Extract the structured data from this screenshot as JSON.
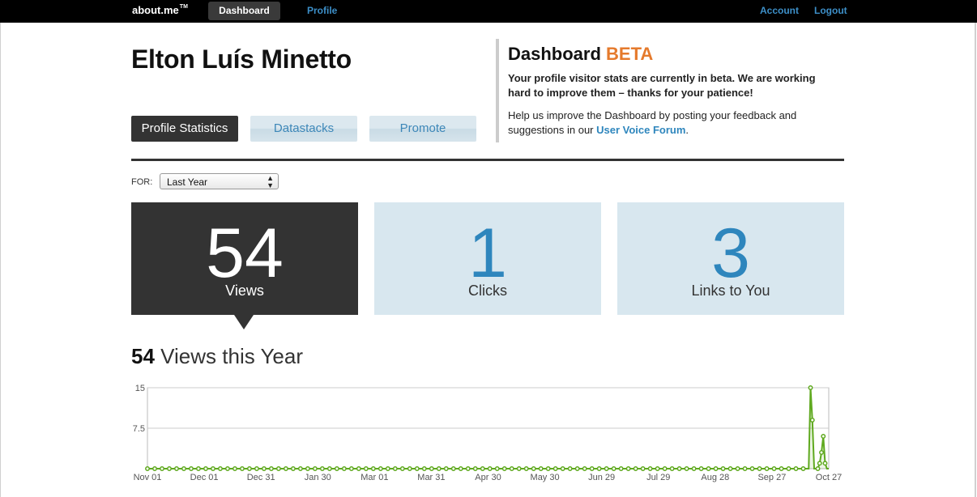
{
  "topbar": {
    "logo": "about.me",
    "logo_tm": "TM",
    "nav": {
      "dashboard": "Dashboard",
      "profile": "Profile",
      "account": "Account",
      "logout": "Logout"
    }
  },
  "profile": {
    "name": "Elton Luís Minetto"
  },
  "tabs": {
    "profile_statistics": "Profile Statistics",
    "datastacks": "Datastacks",
    "promote": "Promote"
  },
  "beta_notice": {
    "title": "Dashboard",
    "title_badge": "BETA",
    "bold_text": "Your profile visitor stats are currently in beta. We are working hard to improve them – thanks for your patience!",
    "help_prefix": "Help us improve the Dashboard by posting your feedback and suggestions in our ",
    "help_link": "User Voice Forum",
    "help_suffix": "."
  },
  "filter": {
    "label": "FOR:",
    "selected": "Last Year"
  },
  "stats": {
    "views": {
      "value": "54",
      "label": "Views"
    },
    "clicks": {
      "value": "1",
      "label": "Clicks"
    },
    "links": {
      "value": "3",
      "label": "Links to You"
    }
  },
  "chart_heading": {
    "count": "54",
    "text": "Views this Year"
  },
  "colors": {
    "accent": "#e57a2c",
    "link": "#2e86bd",
    "series": "#5fa91f",
    "dark": "#333333",
    "tile_bg": "#d8e7ef"
  },
  "chart_data": {
    "type": "line",
    "title": "",
    "xlabel": "",
    "ylabel": "",
    "ylim": [
      0,
      15
    ],
    "yticks": [
      "15",
      "7.5"
    ],
    "x_tick_labels": [
      "Nov 01",
      "Dec 01",
      "Dec 31",
      "Jan 30",
      "Mar 01",
      "Mar 31",
      "Apr 30",
      "May 30",
      "Jun 29",
      "Jul 29",
      "Aug 28",
      "Sep 27",
      "Oct 27"
    ],
    "grid": true,
    "series": [
      {
        "values": [
          0,
          0,
          0,
          0,
          0,
          0,
          0,
          0,
          0,
          0,
          0,
          0,
          0,
          0,
          0,
          0,
          0,
          0,
          0,
          0,
          0,
          0,
          0,
          0,
          0,
          0,
          0,
          0,
          0,
          0,
          0,
          0,
          0,
          0,
          0,
          0,
          0,
          0,
          0,
          0,
          0,
          0,
          0,
          0,
          0,
          0,
          0,
          0,
          0,
          0,
          0,
          0,
          0,
          0,
          0,
          0,
          0,
          0,
          0,
          0,
          0,
          0,
          0,
          0,
          0,
          0,
          0,
          0,
          0,
          0,
          0,
          0,
          0,
          0,
          0,
          0,
          0,
          0,
          0,
          0,
          0,
          0,
          0,
          0,
          0,
          0,
          0,
          0,
          0,
          0,
          0,
          0,
          0,
          0,
          0,
          0,
          0,
          0,
          0,
          0,
          0,
          0,
          0,
          0,
          0,
          0,
          0,
          0,
          0,
          0,
          0,
          0,
          0,
          0,
          0,
          0,
          0,
          0,
          0,
          0,
          0,
          0,
          0,
          0,
          0,
          0,
          0,
          0,
          0,
          0,
          0,
          0,
          0,
          0,
          0,
          0,
          0,
          0,
          0,
          0,
          0,
          0,
          0,
          0,
          0,
          0,
          0,
          0,
          0,
          0,
          0,
          0,
          0,
          0,
          0,
          0,
          0,
          0,
          0,
          0,
          0,
          0,
          0,
          0,
          0,
          0,
          0,
          0,
          0,
          0,
          0,
          0,
          0,
          0,
          0,
          0,
          0,
          0,
          0,
          0,
          0,
          0,
          0,
          0,
          0,
          0,
          0,
          0,
          0,
          0,
          0,
          0,
          0,
          0,
          0,
          0,
          0,
          0,
          0,
          0,
          0,
          0,
          0,
          0,
          0,
          0,
          0,
          0,
          0,
          0,
          0,
          0,
          0,
          0,
          0,
          0,
          0,
          0,
          0,
          0,
          0,
          0,
          0,
          0,
          0,
          0,
          0,
          0,
          0,
          0,
          0,
          0,
          0,
          0,
          0,
          0,
          0,
          0,
          0,
          0,
          0,
          0,
          0,
          0,
          0,
          0,
          0,
          0,
          0,
          0,
          0,
          0,
          0,
          0,
          0,
          0,
          0,
          0,
          0,
          0,
          0,
          0,
          0,
          0,
          0,
          0,
          0,
          0,
          0,
          0,
          0,
          0,
          0,
          0,
          0,
          0,
          0,
          0,
          0,
          0,
          0,
          0,
          0,
          0,
          0,
          0,
          0,
          0,
          0,
          0,
          0,
          0,
          0,
          0,
          0,
          0,
          0,
          0,
          0,
          0,
          0,
          0,
          0,
          0,
          0,
          0,
          0,
          0,
          0,
          0,
          0,
          0,
          0,
          0,
          0,
          0,
          0,
          0,
          0,
          0,
          0,
          0,
          0,
          0,
          0,
          0,
          0,
          0,
          0,
          0,
          0,
          0,
          0,
          0,
          0,
          0,
          0,
          0,
          0,
          0,
          0,
          0,
          0,
          0,
          0,
          0,
          0,
          0,
          0,
          0,
          0,
          0,
          0,
          0,
          0,
          0,
          0,
          0,
          0,
          0,
          0,
          0,
          0,
          0,
          15,
          9,
          0,
          0,
          0,
          1,
          3,
          6,
          1,
          0,
          0
        ]
      }
    ]
  }
}
